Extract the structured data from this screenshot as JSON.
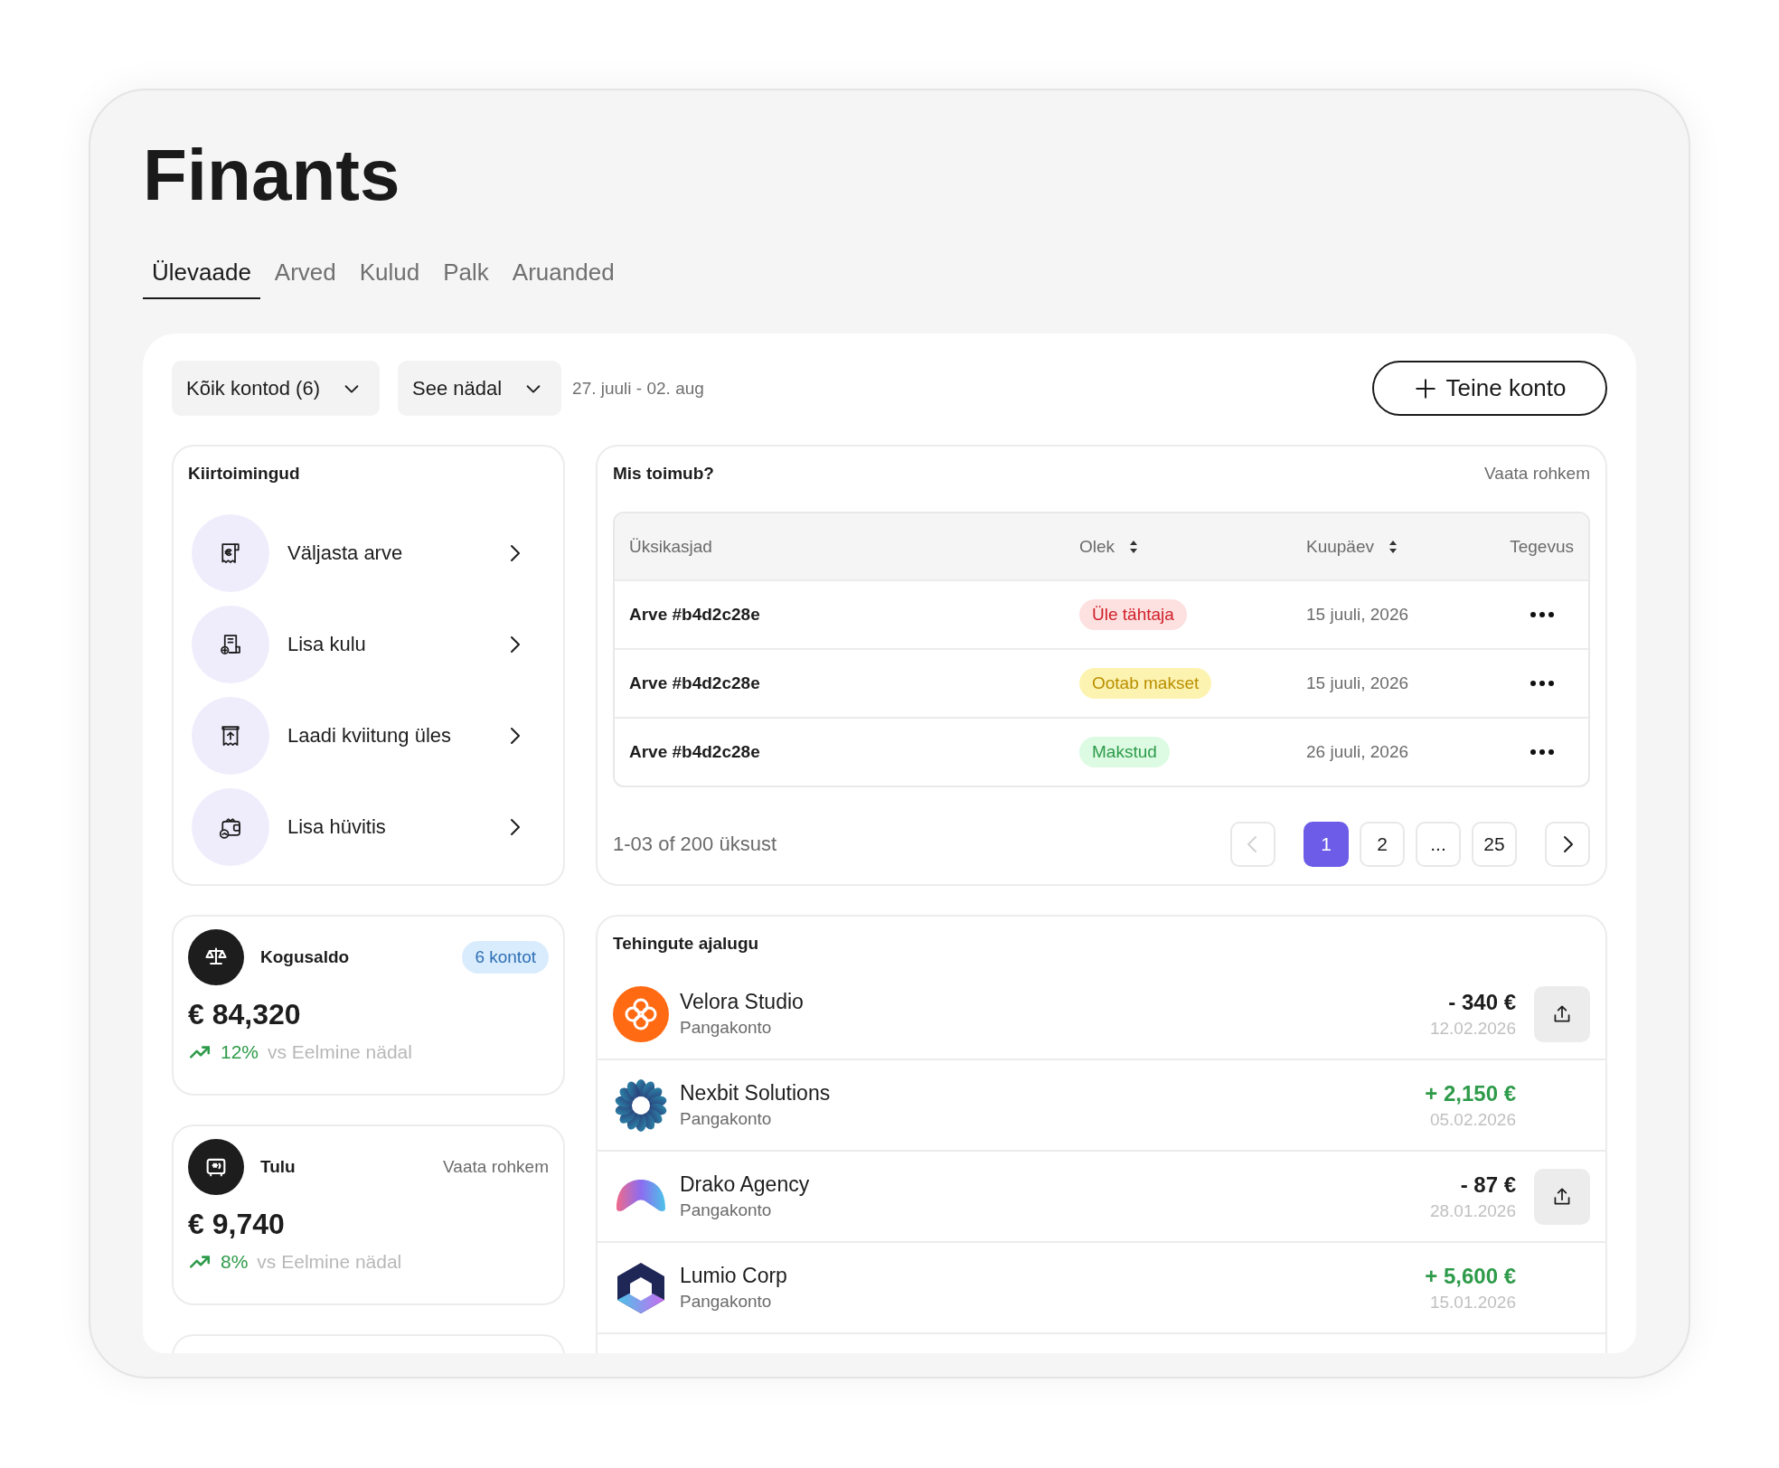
{
  "title": "Finants",
  "tabs": [
    {
      "label": "Ülevaade",
      "selected": true
    },
    {
      "label": "Arved",
      "selected": false
    },
    {
      "label": "Kulud",
      "selected": false
    },
    {
      "label": "Palk",
      "selected": false
    },
    {
      "label": "Aruanded",
      "selected": false
    }
  ],
  "filters": [
    {
      "label": "Kõik kontod (6)"
    },
    {
      "label": "See nädal"
    }
  ],
  "date_range": "27. juuli - 02. aug",
  "add_button": "Teine konto",
  "quick_actions": {
    "title": "Kiirtoimingud",
    "items": [
      {
        "label": "Väljasta arve",
        "kind": "invoice"
      },
      {
        "label": "Lisa kulu",
        "kind": "expense"
      },
      {
        "label": "Laadi kviitung üles",
        "kind": "receipt"
      },
      {
        "label": "Lisa hüvitis",
        "kind": "wallet"
      }
    ]
  },
  "summary_cards": [
    {
      "kind": "balance",
      "title": "Kogusaldo",
      "badge": "6 kontot",
      "amount": "€ 84,320",
      "change": "12%",
      "change_note": "vs Eelmine nädal"
    },
    {
      "kind": "income",
      "title": "Tulu",
      "link": "Vaata rohkem",
      "amount": "€ 9,740",
      "change": "8%",
      "change_note": "vs Eelmine nädal"
    }
  ],
  "activity": {
    "title": "Mis toimub?",
    "link": "Vaata rohkem",
    "columns": [
      {
        "label": "Üksikasjad",
        "sortable": false
      },
      {
        "label": "Olek",
        "sortable": true
      },
      {
        "label": "Kuupäev",
        "sortable": true
      },
      {
        "label": "Tegevus",
        "sortable": false
      }
    ],
    "rows": [
      {
        "item": "Arve #b4d2c28e",
        "status": {
          "label": "Üle tähtaja",
          "kind": "overdue"
        },
        "date": "15 juuli, 2026"
      },
      {
        "item": "Arve #b4d2c28e",
        "status": {
          "label": "Ootab makset",
          "kind": "pending"
        },
        "date": "15 juuli, 2026"
      },
      {
        "item": "Arve #b4d2c28e",
        "status": {
          "label": "Makstud",
          "kind": "paid"
        },
        "date": "26 juuli, 2026"
      }
    ],
    "pagination": {
      "summary": "1-03 of 200 üksust",
      "previous": {
        "disabled": true
      },
      "next": {
        "disabled": false
      },
      "pages": [
        {
          "label": "1",
          "selected": true
        },
        {
          "label": "2",
          "selected": false
        },
        {
          "label": "...",
          "selected": false
        },
        {
          "label": "25",
          "selected": false
        }
      ]
    }
  },
  "transactions": {
    "title": "Tehingute ajalugu",
    "rows": [
      {
        "kind": "flower",
        "name": "Velora Studio",
        "account": "Pangakonto",
        "amount": "- 340 €",
        "color": "#1d1d1d",
        "date": "12.02.2026",
        "exportable": true
      },
      {
        "kind": "burst",
        "name": "Nexbit Solutions",
        "account": "Pangakonto",
        "amount": "+ 2,150 €",
        "color": "#2e9b4a",
        "date": "05.02.2026",
        "exportable": false
      },
      {
        "kind": "arch",
        "name": "Drako Agency",
        "account": "Pangakonto",
        "amount": "- 87 €",
        "color": "#1d1d1d",
        "date": "28.01.2026",
        "exportable": true
      },
      {
        "kind": "hexagon",
        "name": "Lumio Corp",
        "account": "Pangakonto",
        "amount": "+ 5,600 €",
        "color": "#2e9b4a",
        "date": "15.01.2026",
        "exportable": false
      }
    ]
  }
}
